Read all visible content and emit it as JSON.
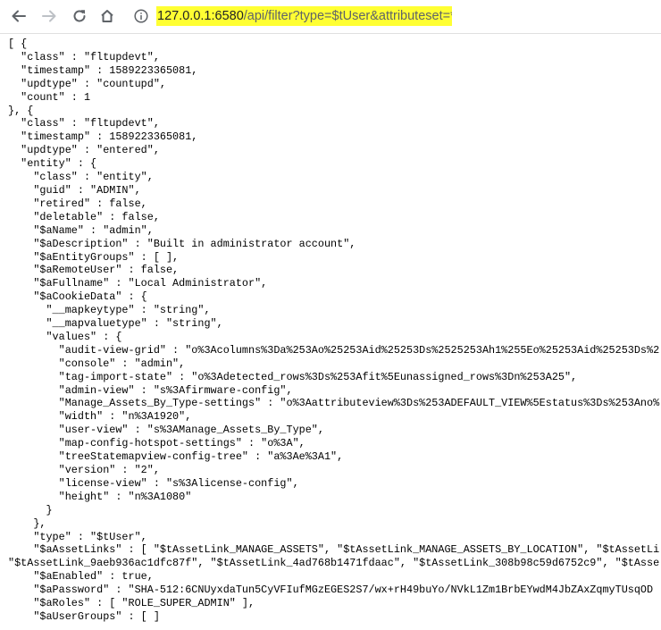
{
  "browser": {
    "url_host": "127.0.0.1:6580",
    "url_rest": "/api/filter?type=$tUser&attributeset=*",
    "url_highlight_color": "#ffff33",
    "icons": [
      "back-arrow-icon",
      "forward-arrow-icon",
      "reload-icon",
      "home-icon",
      "info-icon"
    ]
  },
  "json_lines": [
    "[ {",
    "  \"class\" : \"fltupdevt\",",
    "  \"timestamp\" : 1589223365081,",
    "  \"updtype\" : \"countupd\",",
    "  \"count\" : 1",
    "}, {",
    "  \"class\" : \"fltupdevt\",",
    "  \"timestamp\" : 1589223365081,",
    "  \"updtype\" : \"entered\",",
    "  \"entity\" : {",
    "    \"class\" : \"entity\",",
    "    \"guid\" : \"ADMIN\",",
    "    \"retired\" : false,",
    "    \"deletable\" : false,",
    "    \"$aName\" : \"admin\",",
    "    \"$aDescription\" : \"Built in administrator account\",",
    "    \"$aEntityGroups\" : [ ],",
    "    \"$aRemoteUser\" : false,",
    "    \"$aFullname\" : \"Local Administrator\",",
    "    \"$aCookieData\" : {",
    "      \"__mapkeytype\" : \"string\",",
    "      \"__mapvaluetype\" : \"string\",",
    "      \"values\" : {",
    "        \"audit-view-grid\" : \"o%3Acolumns%3Da%253Ao%25253Aid%25253Ds%2525253Ah1%255Eo%25253Aid%25253Ds%2",
    "        \"console\" : \"admin\",",
    "        \"tag-import-state\" : \"o%3Adetected_rows%3Ds%253Afit%5Eunassigned_rows%3Dn%253A25\",",
    "        \"admin-view\" : \"s%3Afirmware-config\",",
    "        \"Manage_Assets_By_Type-settings\" : \"o%3Aattributeview%3Ds%253ADEFAULT_VIEW%5Estatus%3Ds%253Ano%",
    "        \"width\" : \"n%3A1920\",",
    "        \"user-view\" : \"s%3AManage_Assets_By_Type\",",
    "        \"map-config-hotspot-settings\" : \"o%3A\",",
    "        \"treeStatemapview-config-tree\" : \"a%3Ae%3A1\",",
    "        \"version\" : \"2\",",
    "        \"license-view\" : \"s%3Alicense-config\",",
    "        \"height\" : \"n%3A1080\"",
    "      }",
    "    },",
    "    \"type\" : \"$tUser\",",
    "    \"$aAssetLinks\" : [ \"$tAssetLink_MANAGE_ASSETS\", \"$tAssetLink_MANAGE_ASSETS_BY_LOCATION\", \"$tAssetLi",
    "\"$tAssetLink_9aeb936ac1dfc87f\", \"$tAssetLink_4ad768b1471fdaac\", \"$tAssetLink_308b98c59d6752c9\", \"$tAsse",
    "    \"$aEnabled\" : true,",
    "    \"$aPassword\" : \"SHA-512:6CNUyxdaTun5CyVFIufMGzEGES2S7/wx+rH49buYo/NVkL1Zm1BrbEYwdM4JbZAxZqmyTUsqOD",
    "    \"$aRoles\" : [ \"ROLE_SUPER_ADMIN\" ],",
    "    \"$aUserGroups\" : [ ]"
  ]
}
